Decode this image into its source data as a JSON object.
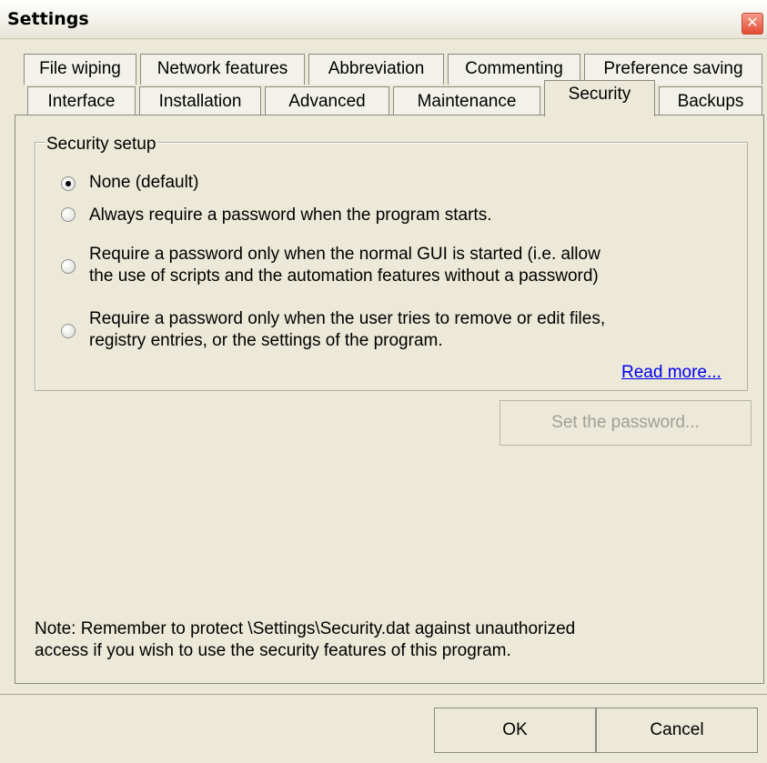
{
  "window": {
    "title": "Settings"
  },
  "tabs": {
    "row1": [
      "File wiping",
      "Network features",
      "Abbreviation",
      "Commenting",
      "Preference saving"
    ],
    "row2": [
      "Interface",
      "Installation",
      "Advanced",
      "Maintenance",
      "Security",
      "Backups"
    ],
    "active": "Security"
  },
  "security": {
    "group_label": "Security setup",
    "options": [
      {
        "label": "None  (default)",
        "selected": true
      },
      {
        "label": "Always require a password when the program starts.",
        "selected": false
      },
      {
        "line1": "Require a password only when the normal GUI is started (i.e. allow",
        "line2": "the use of scripts and the automation features without a password)",
        "selected": false
      },
      {
        "line1": "Require a password only when the user tries to remove or edit files,",
        "line2": "registry entries, or the settings of the program.",
        "selected": false
      }
    ],
    "read_more": "Read more...",
    "set_password_label": "Set the password..."
  },
  "note": {
    "line1": "Note: Remember to protect \\Settings\\Security.dat against unauthorized",
    "line2": "access if you wish to use the security features of this program."
  },
  "footer": {
    "ok_label": "OK",
    "cancel_label": "Cancel"
  }
}
